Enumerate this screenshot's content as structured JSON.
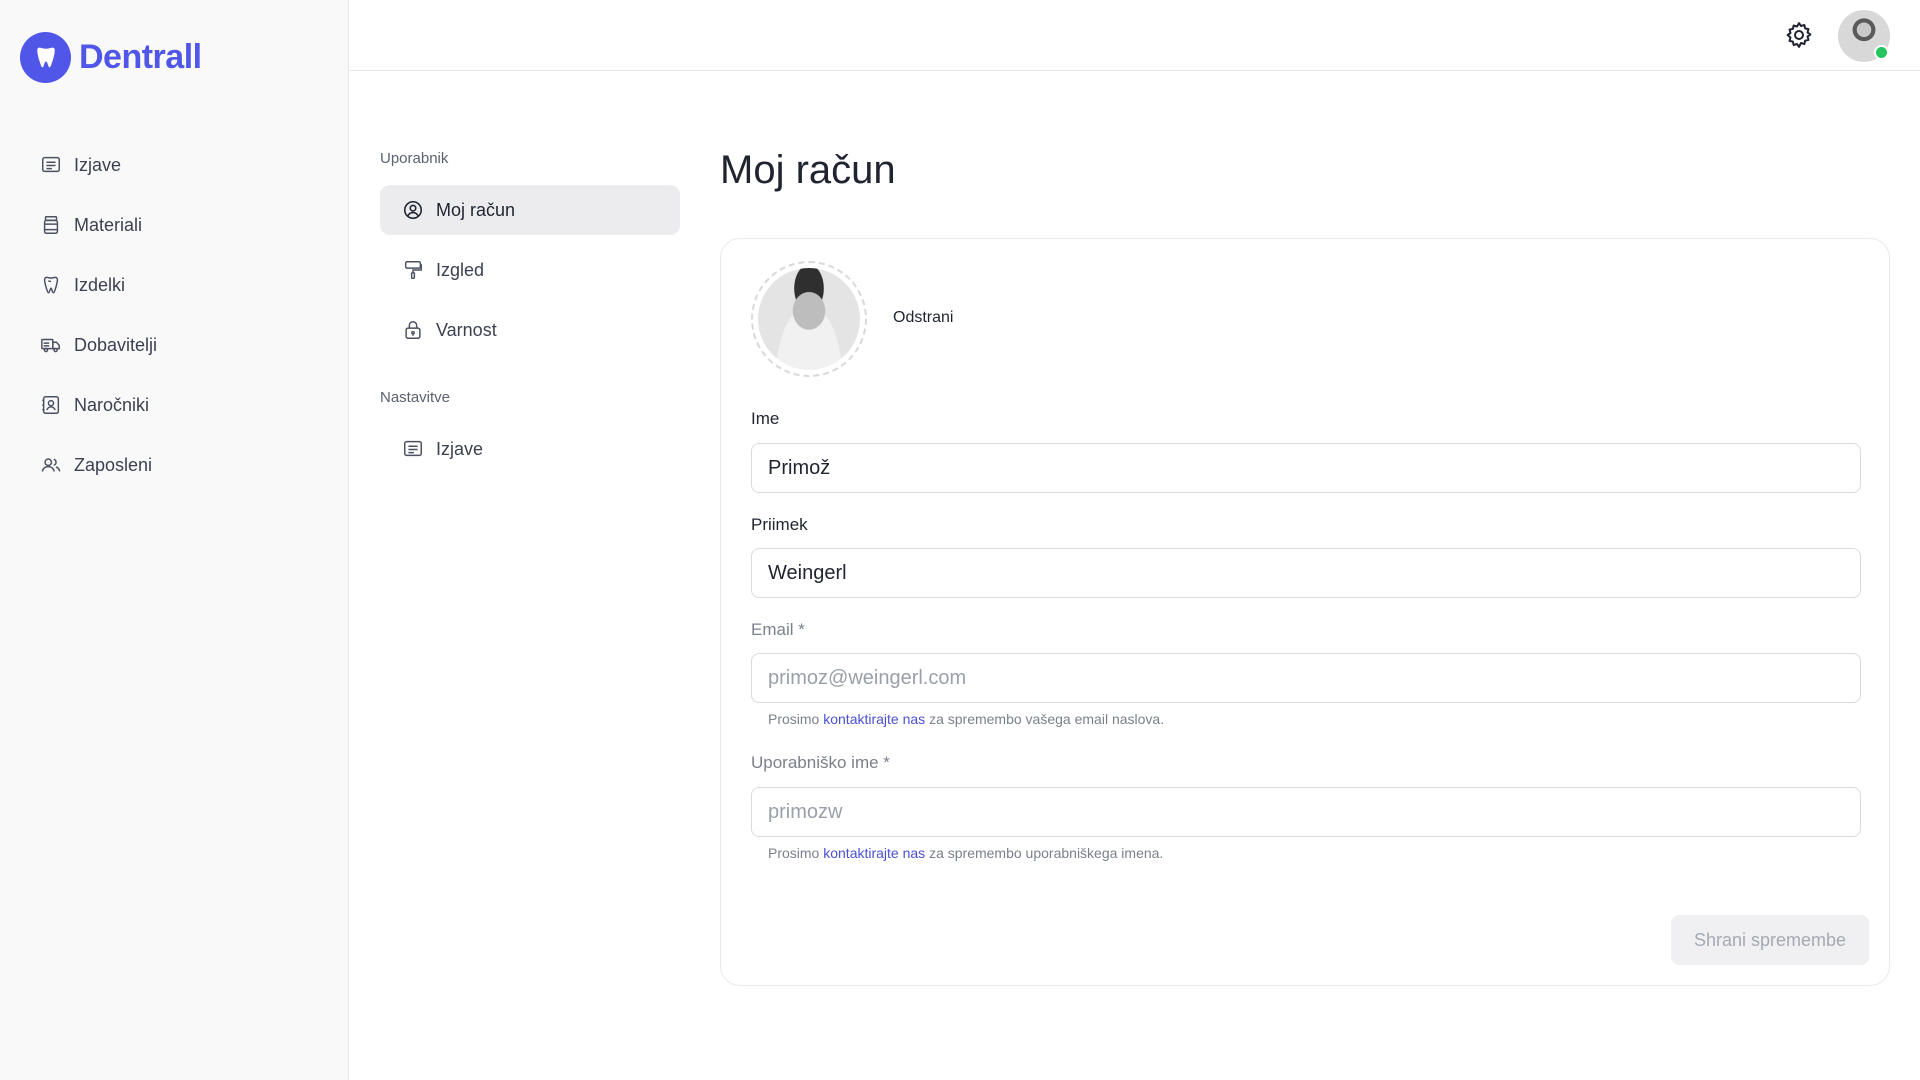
{
  "app": {
    "name": "Dentrall",
    "brand_color": "#5056e8"
  },
  "sidebar": {
    "items": [
      {
        "label": "Izjave",
        "icon": "document-list-icon"
      },
      {
        "label": "Materiali",
        "icon": "jar-icon"
      },
      {
        "label": "Izdelki",
        "icon": "tooth-icon"
      },
      {
        "label": "Dobavitelji",
        "icon": "truck-icon"
      },
      {
        "label": "Naročniki",
        "icon": "contact-card-icon"
      },
      {
        "label": "Zaposleni",
        "icon": "users-icon"
      }
    ]
  },
  "topbar": {
    "settings_icon": "gear-icon",
    "avatar_status": "online",
    "status_color": "#22c55e"
  },
  "subnav": {
    "section_user": "Uporabnik",
    "user_items": [
      {
        "label": "Moj račun",
        "icon": "user-circle-icon",
        "active": true
      },
      {
        "label": "Izgled",
        "icon": "paint-roller-icon",
        "active": false
      },
      {
        "label": "Varnost",
        "icon": "lock-icon",
        "active": false
      }
    ],
    "section_settings": "Nastavitve",
    "settings_items": [
      {
        "label": "Izjave",
        "icon": "document-list-icon",
        "active": false
      }
    ]
  },
  "main": {
    "title": "Moj račun",
    "remove_label": "Odstrani",
    "first_name": {
      "label": "Ime",
      "value": "Primož"
    },
    "last_name": {
      "label": "Priimek",
      "value": "Weingerl"
    },
    "email": {
      "label": "Email *",
      "value": "primoz@weingerl.com",
      "hint_before": "Prosimo ",
      "hint_link": "kontaktirajte nas",
      "hint_after": " za spremembo vašega email naslova."
    },
    "username": {
      "label": "Uporabniško ime *",
      "value": "primozw",
      "hint_before": "Prosimo ",
      "hint_link": "kontaktirajte nas",
      "hint_after": " za spremembo uporabniškega imena."
    },
    "save_label": "Shrani spremembe"
  }
}
